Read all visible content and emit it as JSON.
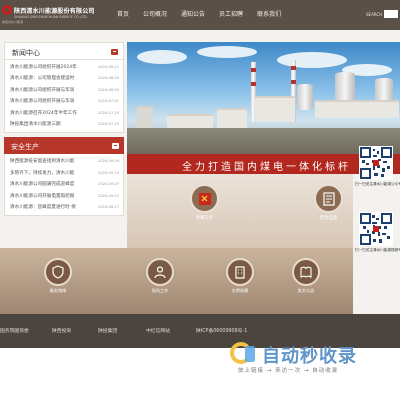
{
  "header": {
    "company_cn": "陕西清水川能源股份有限公司",
    "company_en": "SHAANXI QINGSHUICHUAN ENERGY CO.,LTD.",
    "company_sub": "陕西清水川能源",
    "nav": [
      "首页",
      "公司概况",
      "通知公告",
      "员工招聘",
      "联系我们"
    ],
    "search_label": "SEARCH"
  },
  "news": {
    "title": "新闻中心",
    "items": [
      {
        "text": "清水川能源公司组织开展2024年",
        "date": "2024-08-11"
      },
      {
        "text": "清水川能源：公司管理会建运村",
        "date": "2024-08-05"
      },
      {
        "text": "清水川能源公司组织开展与华润",
        "date": "2024-08-05"
      },
      {
        "text": "清水川能源公司组织开展与华润",
        "date": "2024-07-31"
      },
      {
        "text": "清水川能源召开2024年半年工作",
        "date": "2024-07-29"
      },
      {
        "text": "陕投集团清水川能源三期",
        "date": "2024-07-23"
      }
    ]
  },
  "safety": {
    "title": "安全生产",
    "items": [
      {
        "text": "陕西能源投安督查组到清水川能",
        "date": "2024-09-09"
      },
      {
        "text": "多管齐下，持续发力，清水川能",
        "date": "2024-09-14"
      },
      {
        "text": "清水川能源公司圆满完成迎峰度",
        "date": "2024-09-07"
      },
      {
        "text": "清水川能源公司开展电量再挖掘",
        "date": "2024-09-07"
      },
      {
        "text": "清水川能源：迎峰度夏进行时 保",
        "date": "2024-08-17"
      }
    ]
  },
  "banner": {
    "slogan": "全力打造国内煤电一体化标杆"
  },
  "tiles": [
    {
      "label": "党建工作",
      "icon": "party-flag-icon"
    },
    {
      "label": "综合信息",
      "icon": "document-icon"
    }
  ],
  "gold_tiles": [
    {
      "label": "服务指南",
      "icon": "shield-icon"
    },
    {
      "label": "党风工作",
      "icon": "person-icon"
    },
    {
      "label": "文明创建",
      "icon": "building-icon"
    },
    {
      "label": "发文公告",
      "icon": "book-icon"
    }
  ],
  "qr": {
    "label1": "扫一扫关注清水川能源公众号",
    "label2": "扫一扫关注清水川能源视频号"
  },
  "footer_links": [
    "国务院国资委",
    "陕西投资",
    "陕投集团",
    "中红信网站",
    "陕ICP备06009908号-1"
  ],
  "watermark": {
    "title": "自动秒收录",
    "sub": "放上链接 → 来访一次 → 自动收录"
  },
  "colors": {
    "header_bg": "#5a5048",
    "accent_red": "#b3281e",
    "footer_bar": "#4b443f"
  }
}
